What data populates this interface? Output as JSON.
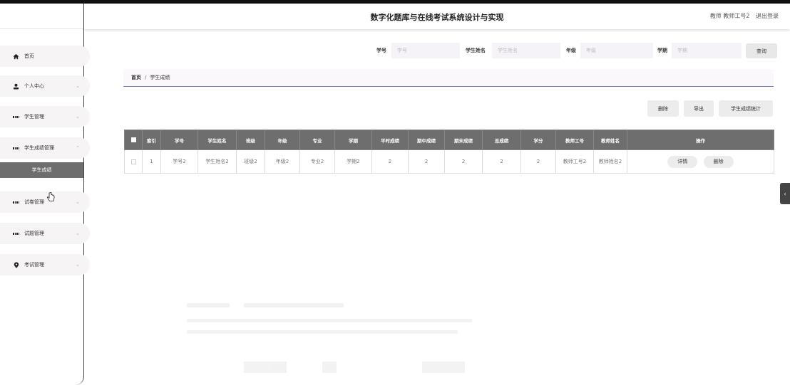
{
  "header": {
    "title": "数字化题库与在线考试系统设计与实现",
    "user_label": "教师 教师工号2",
    "logout_label": "退出登录"
  },
  "sidebar": {
    "items": [
      {
        "label": "首页",
        "icon": "home-icon"
      },
      {
        "label": "个人中心",
        "icon": "user-icon"
      },
      {
        "label": "学生管理",
        "icon": "grid-icon"
      },
      {
        "label": "学生成绩管理",
        "icon": "grid-icon"
      },
      {
        "label": "试卷管理",
        "icon": "grid-icon"
      },
      {
        "label": "试题管理",
        "icon": "grid-icon"
      },
      {
        "label": "考试管理",
        "icon": "pin-icon"
      }
    ],
    "sub_item": "学生成绩"
  },
  "search": {
    "student_id_label": "学号",
    "student_id_placeholder": "学号",
    "student_name_label": "学生姓名",
    "student_name_placeholder": "学生姓名",
    "grade_label": "年级",
    "grade_placeholder": "年级",
    "term_label": "学期",
    "term_placeholder": "学期",
    "query_label": "查询"
  },
  "breadcrumb": {
    "home": "首页",
    "separator": "/",
    "current": "学生成绩"
  },
  "actions": {
    "delete_label": "删除",
    "export_label": "导出",
    "stats_label": "学生成绩统计"
  },
  "table": {
    "columns": [
      "索引",
      "学号",
      "学生姓名",
      "班级",
      "年级",
      "专业",
      "学期",
      "平时成绩",
      "期中成绩",
      "期末成绩",
      "总成绩",
      "学分",
      "教师工号",
      "教师姓名",
      "操作"
    ],
    "rows": [
      {
        "cells": [
          "1",
          "学号2",
          "学生姓名2",
          "班级2",
          "年级2",
          "专业2",
          "学期2",
          "2",
          "2",
          "2",
          "2",
          "2",
          "教师工号2",
          "教师姓名2"
        ],
        "detail_label": "详情",
        "delete_label": "删除"
      }
    ]
  },
  "side_tab": "‹"
}
